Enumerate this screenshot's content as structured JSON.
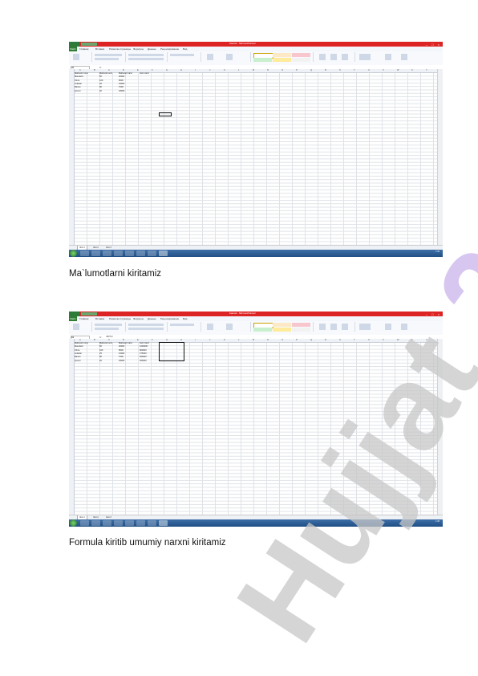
{
  "screens": [
    {
      "window_title": "Книга1 - Microsoft Excel",
      "file_tab": "Файл",
      "tabs": [
        "Главная",
        "Вставка",
        "Разметка страницы",
        "Формулы",
        "Данные",
        "Рецензирование",
        "Вид"
      ],
      "name_box": "I11",
      "formula": "",
      "column_headers": [
        "A",
        "B",
        "C",
        "D",
        "E",
        "F",
        "G",
        "H",
        "I",
        "J",
        "K",
        "L",
        "M",
        "N",
        "O",
        "P",
        "Q",
        "R",
        "S",
        "T",
        "U",
        "V",
        "W",
        "X",
        "Y"
      ],
      "table": [
        [
          "Mahsulot nomi",
          "Mahsulot soni",
          "Mahsulot narxi",
          "Jami narxi"
        ],
        [
          "Mandarin",
          "50",
          "20000",
          ""
        ],
        [
          "Olma",
          "100",
          "8000",
          ""
        ],
        [
          "Gullular",
          "25",
          "15000",
          ""
        ],
        [
          "Banan",
          "80",
          "7000",
          ""
        ],
        [
          "Qovun",
          "20",
          "18000",
          ""
        ]
      ],
      "sheet_tabs": [
        "Лист1",
        "Лист2",
        "Лист3"
      ],
      "status": "Готово",
      "zoom": "100%",
      "clock": "1:06"
    },
    {
      "window_title": "Книга1 - Microsoft Excel",
      "file_tab": "Файл",
      "tabs": [
        "Главная",
        "Вставка",
        "Разметка страницы",
        "Формулы",
        "Данные",
        "Рецензирование",
        "Вид"
      ],
      "name_box": "D2",
      "formula": "=B2*C2",
      "column_headers": [
        "A",
        "B",
        "C",
        "D",
        "E",
        "F",
        "G",
        "H",
        "I",
        "J",
        "K",
        "L",
        "M",
        "N",
        "O",
        "P",
        "Q",
        "R",
        "S",
        "T",
        "U",
        "V",
        "W",
        "X",
        "Y"
      ],
      "table": [
        [
          "Mahsulot nomi",
          "Mahsulot soni",
          "Mahsulot narxi",
          "Jami narxi"
        ],
        [
          "Mandarin",
          "50",
          "20000",
          "1000000"
        ],
        [
          "Olma",
          "100",
          "8000",
          "800000"
        ],
        [
          "Gullular",
          "25",
          "15000",
          "375000"
        ],
        [
          "Banan",
          "80",
          "7000",
          "560000"
        ],
        [
          "Qovun",
          "20",
          "18000",
          "360000"
        ]
      ],
      "sheet_tabs": [
        "Лист1",
        "Лист2",
        "Лист3"
      ],
      "status": "Готово",
      "zoom": "100%",
      "clock": "1:08"
    }
  ],
  "captions": {
    "first": "Ma`lumotlarni kiritamiz",
    "second": "Formula kiritib umumiy narxni kiritamiz"
  },
  "watermark": {
    "text": "Hujjat 24",
    "color_24": "#c9b3ec",
    "color_hujjat": "#c8c8c8"
  },
  "colors": {
    "titlebar": "#dd2424",
    "file_tab": "#2e7d32",
    "taskbar": "#2a5b93"
  }
}
